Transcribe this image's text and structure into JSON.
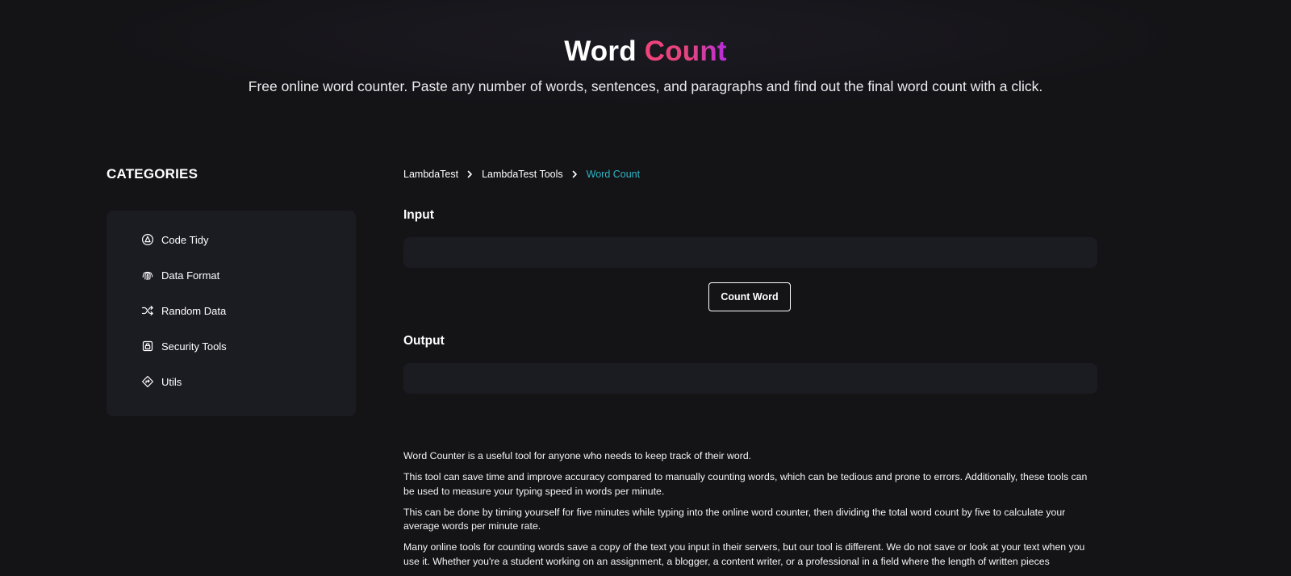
{
  "hero": {
    "title_plain": "Word",
    "title_accent": "Count",
    "subtitle": "Free online word counter. Paste any number of words, sentences, and paragraphs and find out the final word count with a click."
  },
  "sidebar": {
    "title": "CATEGORIES",
    "items": [
      {
        "label": "Code Tidy",
        "icon": "code-tidy-icon"
      },
      {
        "label": "Data Format",
        "icon": "fingerprint-icon"
      },
      {
        "label": "Random Data",
        "icon": "shuffle-icon"
      },
      {
        "label": "Security Tools",
        "icon": "lock-icon"
      },
      {
        "label": "Utils",
        "icon": "diamond-icon"
      }
    ]
  },
  "breadcrumb": {
    "items": [
      "LambdaTest",
      "LambdaTest Tools"
    ],
    "current": "Word Count"
  },
  "input": {
    "label": "Input",
    "value": "",
    "placeholder": ""
  },
  "count_button_label": "Count Word",
  "output": {
    "label": "Output",
    "value": ""
  },
  "description": [
    "Word Counter is a useful tool for anyone who needs to keep track of their word.",
    "This tool can save time and improve accuracy compared to manually counting words, which can be tedious and prone to errors. Additionally, these tools can be used to measure your typing speed in words per minute.",
    "This can be done by timing yourself for five minutes while typing into the online word counter, then dividing the total word count by five to calculate your average words per minute rate.",
    "Many online tools for counting words save a copy of the text you input in their servers, but our tool is different. We do not save or look at your text when you use it. Whether you're a student working on an assignment, a blogger, a content writer, or a professional in a field where the length of written pieces"
  ],
  "colors": {
    "background": "#141417",
    "panel": "#1b1b22",
    "accent_start": "#f0437a",
    "accent_end": "#b52de0",
    "breadcrumb_current": "#2db6c6"
  }
}
